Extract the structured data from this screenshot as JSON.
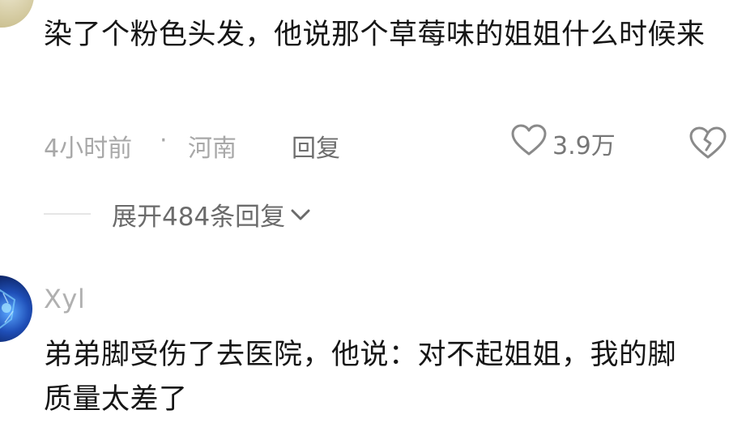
{
  "comments": [
    {
      "text": "染了个粉色头发，他说那个草莓味的姐姐什么时候来",
      "time": "4小时前",
      "separator": "·",
      "location": "河南",
      "reply_label": "回复",
      "like_count": "3.9万",
      "expand_replies_label": "展开484条回复"
    },
    {
      "username": "Xyl",
      "text": "弟弟脚受伤了去医院，他说：对不起姐姐，我的脚质量太差了"
    }
  ]
}
